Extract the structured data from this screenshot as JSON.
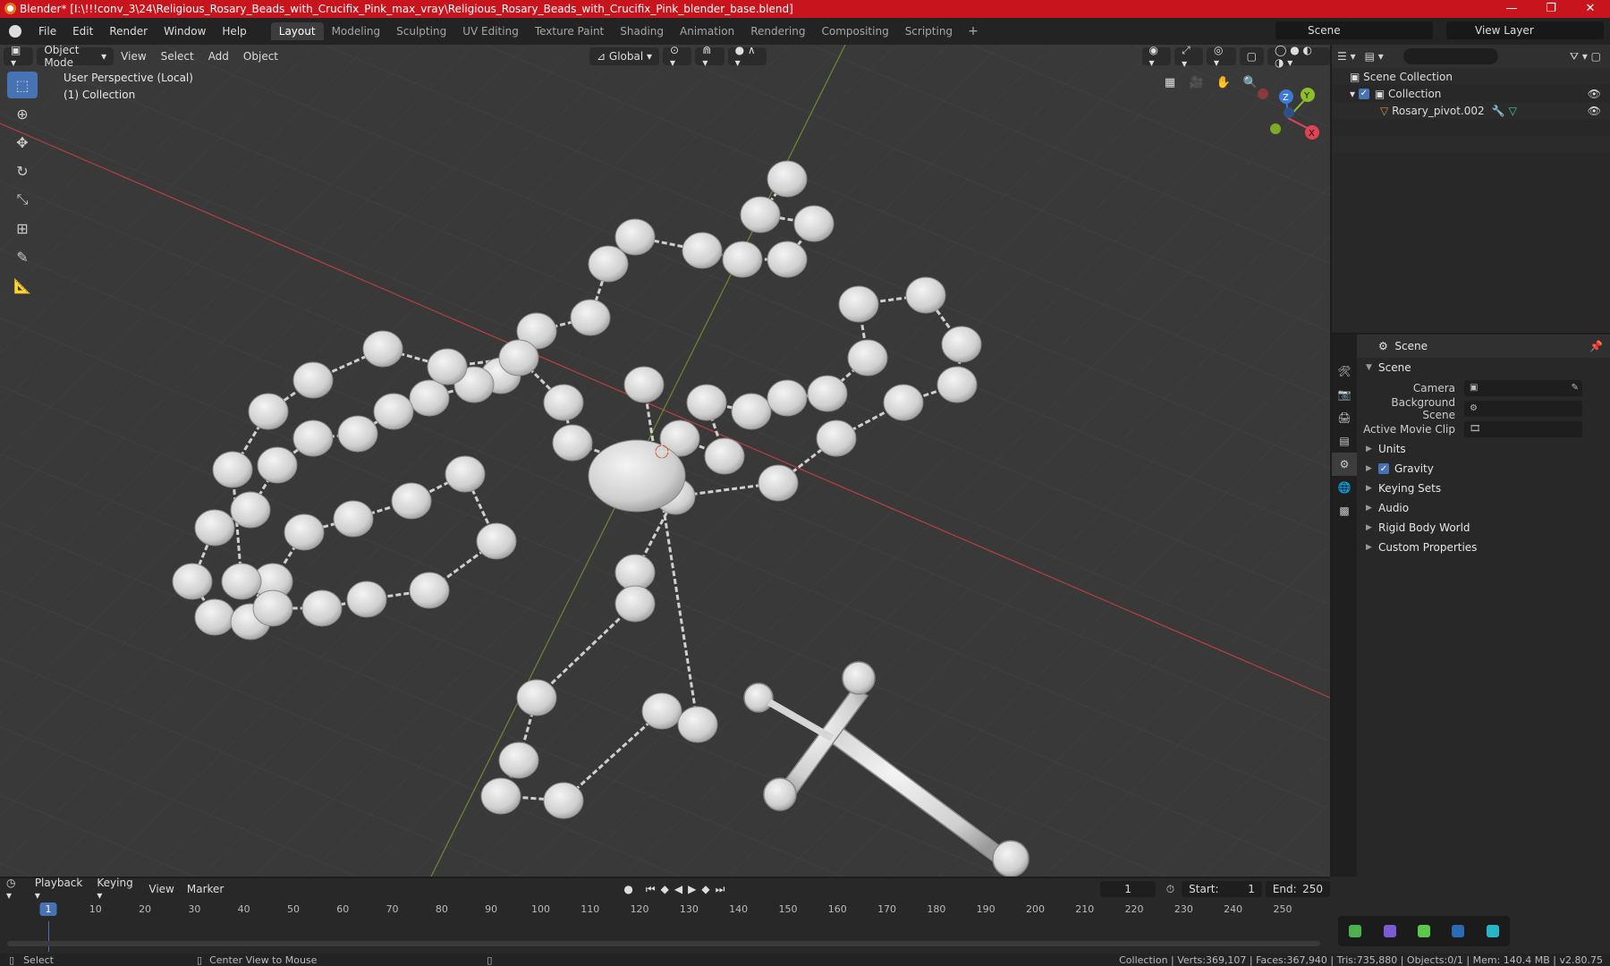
{
  "window": {
    "title": "Blender* [I:\\!!!conv_3\\24\\Religious_Rosary_Beads_with_Crucifix_Pink_max_vray\\Religious_Rosary_Beads_with_Crucifix_Pink_blender_base.blend]",
    "minimize": "—",
    "maximize": "❐",
    "close": "✕"
  },
  "menu": [
    "File",
    "Edit",
    "Render",
    "Window",
    "Help"
  ],
  "workspaces": [
    "Layout",
    "Modeling",
    "Sculpting",
    "UV Editing",
    "Texture Paint",
    "Shading",
    "Animation",
    "Rendering",
    "Compositing",
    "Scripting"
  ],
  "active_workspace": "Layout",
  "scene_selector": "Scene",
  "view_layer": "View Layer",
  "viewport": {
    "mode": "Object Mode",
    "menus": [
      "View",
      "Select",
      "Add",
      "Object"
    ],
    "orientation": "Global",
    "info_line1": "User Perspective (Local)",
    "info_line2": "(1) Collection",
    "gizmo": {
      "x": "X",
      "y": "Y",
      "z": "Z"
    }
  },
  "outliner": {
    "rows": [
      "Scene Collection",
      "Collection",
      "Rosary_pivot.002"
    ]
  },
  "properties": {
    "header": "Scene",
    "panel": "Scene",
    "fields": [
      {
        "label": "Camera"
      },
      {
        "label": "Background Scene"
      },
      {
        "label": "Active Movie Clip"
      }
    ],
    "sections": [
      "Units",
      "Gravity",
      "Keying Sets",
      "Audio",
      "Rigid Body World",
      "Custom Properties"
    ]
  },
  "timeline": {
    "menus": [
      "Playback",
      "Keying",
      "View",
      "Marker"
    ],
    "current_frame": "1",
    "start_label": "Start:",
    "start": "1",
    "end_label": "End:",
    "end": "250",
    "ticks": [
      "1",
      "10",
      "20",
      "30",
      "40",
      "50",
      "60",
      "70",
      "80",
      "90",
      "100",
      "110",
      "120",
      "130",
      "140",
      "150",
      "160",
      "170",
      "180",
      "190",
      "200",
      "210",
      "220",
      "230",
      "240",
      "250"
    ]
  },
  "status": {
    "left": "Select",
    "mid": "Center View to Mouse",
    "right": "Collection | Verts:369,107 | Faces:367,940 | Tris:735,880 | Objects:0/1 | Mem: 140.4 MB | v2.80.75"
  }
}
